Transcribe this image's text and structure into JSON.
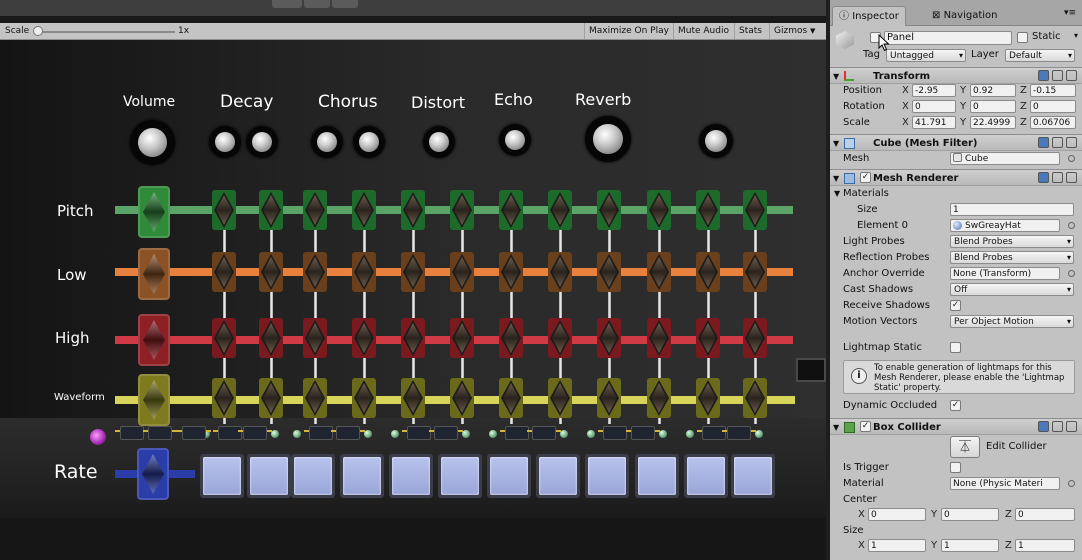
{
  "game_toolbar": {
    "scale_label": "Scale",
    "scale_value": "1x",
    "buttons": [
      "Maximize On Play",
      "Mute Audio",
      "Stats",
      "Gizmos"
    ]
  },
  "game": {
    "effects": [
      "Volume",
      "Decay",
      "Chorus",
      "Distort",
      "Echo",
      "Reverb"
    ],
    "rows": [
      {
        "label": "Pitch",
        "color": "#4f9a5e",
        "slider_color": "#1e6a2a"
      },
      {
        "label": "Low",
        "color": "#e07a3a",
        "slider_color": "#6a3f1c"
      },
      {
        "label": "High",
        "color": "#c93840",
        "slider_color": "#7a1a1e"
      },
      {
        "label": "Waveform",
        "color": "#c9c84a",
        "slider_color": "#6a6a1a"
      }
    ],
    "rate_label": "Rate",
    "rate_color": "#2a3da8",
    "steps": 12
  },
  "inspector": {
    "tabs": {
      "inspector": "Inspector",
      "navigation": "Navigation"
    },
    "object": {
      "name": "Panel",
      "static_label": "Static",
      "tag_label": "Tag",
      "tag_value": "Untagged",
      "layer_label": "Layer",
      "layer_value": "Default"
    },
    "transform": {
      "title": "Transform",
      "position_label": "Position",
      "position": {
        "x": "-2.95",
        "y": "0.92",
        "z": "-0.15"
      },
      "rotation_label": "Rotation",
      "rotation": {
        "x": "0",
        "y": "0",
        "z": "0"
      },
      "scale_label": "Scale",
      "scale": {
        "x": "41.791",
        "y": "22.4999",
        "z": "0.06706"
      }
    },
    "mesh_filter": {
      "title": "Cube (Mesh Filter)",
      "mesh_label": "Mesh",
      "mesh_value": "Cube"
    },
    "mesh_renderer": {
      "title": "Mesh Renderer",
      "materials_label": "Materials",
      "size_label": "Size",
      "size_value": "1",
      "element0_label": "Element 0",
      "element0_value": "SwGreayHat",
      "light_probes_label": "Light Probes",
      "light_probes_value": "Blend Probes",
      "reflection_probes_label": "Reflection Probes",
      "reflection_probes_value": "Blend Probes",
      "anchor_override_label": "Anchor Override",
      "anchor_override_value": "None (Transform)",
      "cast_shadows_label": "Cast Shadows",
      "cast_shadows_value": "Off",
      "receive_shadows_label": "Receive Shadows",
      "motion_vectors_label": "Motion Vectors",
      "motion_vectors_value": "Per Object Motion",
      "lightmap_static_label": "Lightmap Static",
      "help_text": "To enable generation of lightmaps for this Mesh Renderer, please enable the 'Lightmap Static' property.",
      "dynamic_occluded_label": "Dynamic Occluded"
    },
    "box_collider": {
      "title": "Box Collider",
      "edit_collider_label": "Edit Collider",
      "is_trigger_label": "Is Trigger",
      "material_label": "Material",
      "material_value": "None (Physic Materi",
      "center_label": "Center",
      "center": {
        "x": "0",
        "y": "0",
        "z": "0"
      },
      "size_label": "Size",
      "size": {
        "x": "1",
        "y": "1",
        "z": "1"
      }
    },
    "axes": {
      "x": "X",
      "y": "Y",
      "z": "Z"
    }
  }
}
